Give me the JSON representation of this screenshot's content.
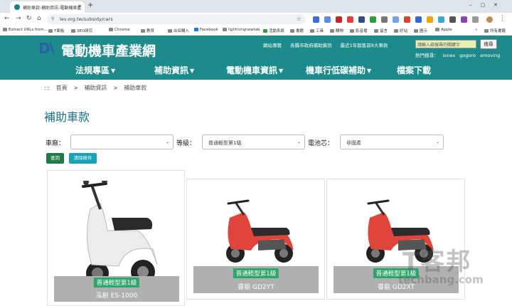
{
  "browser": {
    "tab_title": "補助車款-補助資訊-電動機車產",
    "url": "lev.org.tw/subsidy/cars",
    "bookmarks": [
      "Extract URLs from...",
      "T面板",
      "SEO研究",
      "Chrome",
      "教育",
      "出名購入",
      "Facebook",
      "lightningnewtab",
      "活動系統",
      "書籍",
      "工具",
      "購物",
      "影音檔",
      "留言",
      "好站",
      "圖示",
      "Apple",
      "所有書籤"
    ]
  },
  "site": {
    "logo_mark_left": "D",
    "logo_mark_right": "\\",
    "title": "電動機車產業網",
    "top_links": [
      "網站導覽",
      "各縣市政府補助資訊",
      "最近1年銷售前8大車款"
    ],
    "search_placeholder": "請輸入欲搜尋的關鍵字",
    "search_button": "搜尋",
    "hot_label": "熱門搜尋：",
    "hot_terms": [
      "ionex",
      "gogoro",
      "emoving"
    ],
    "nav": [
      "法規專區",
      "補助資訊",
      "電動機車資訊",
      "機車行低碳補助",
      "檔案下載"
    ]
  },
  "breadcrumb": {
    "prefix": ":::",
    "items": [
      "首頁",
      "補助資訊",
      "補助車款"
    ],
    "separator": ">"
  },
  "page_title": "補助車款",
  "filters": {
    "brand_label": "車廠：",
    "brand_value": "",
    "class_label": "等級：",
    "class_value": "普通輕型第1級",
    "battery_label": "電池芯：",
    "battery_value": "非國產"
  },
  "buttons": {
    "search": "查詢",
    "clear": "清除條件"
  },
  "cars": [
    {
      "badge": "普通輕型第1級",
      "name": "泓創  ES-1000",
      "color": "white"
    },
    {
      "badge": "普通輕型第1級",
      "name": "睿能  GD2YT",
      "color": "red"
    },
    {
      "badge": "普通輕型第1級",
      "name": "睿能  GD2XT",
      "color": "red"
    }
  ],
  "watermark": {
    "text": "T客邦",
    "url": "techbang.com"
  }
}
